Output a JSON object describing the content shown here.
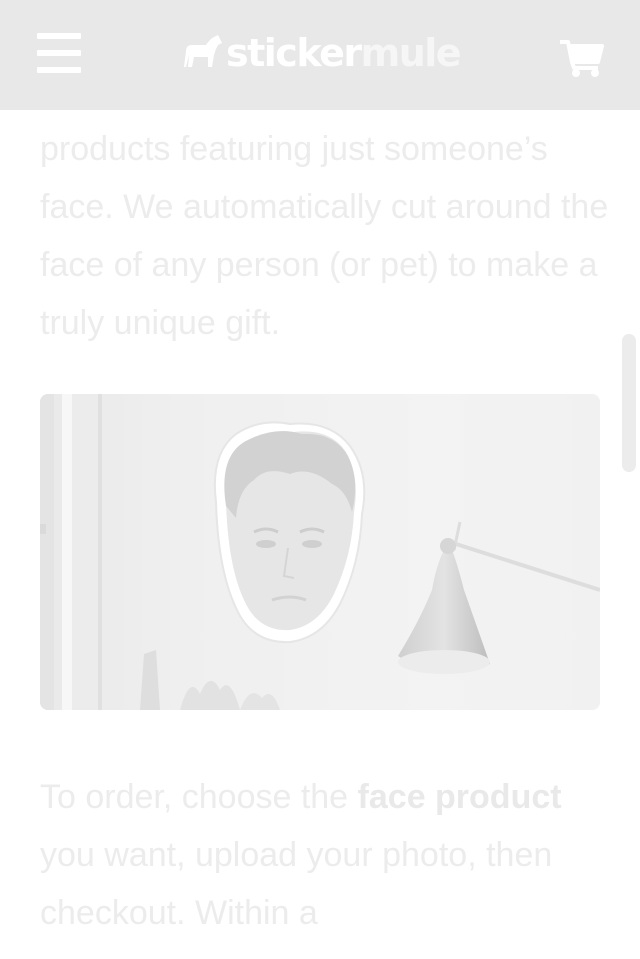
{
  "header": {
    "logo_part1": "sticker",
    "logo_part2": "mule",
    "menu_icon": "hamburger-menu-icon",
    "cart_icon": "shopping-cart-icon",
    "background": "#e8e8e8"
  },
  "article": {
    "paragraph1": "products featuring just someone’s face. We automatically cut around the face of any person (or pet) to make a truly unique gift.",
    "paragraph2_start": "To order, choose the ",
    "paragraph2_bold": "face product",
    "paragraph2_end": " you want, upload your photo, then checkout. Within a"
  },
  "image": {
    "subject": "face-sticker-on-wall-photo"
  }
}
